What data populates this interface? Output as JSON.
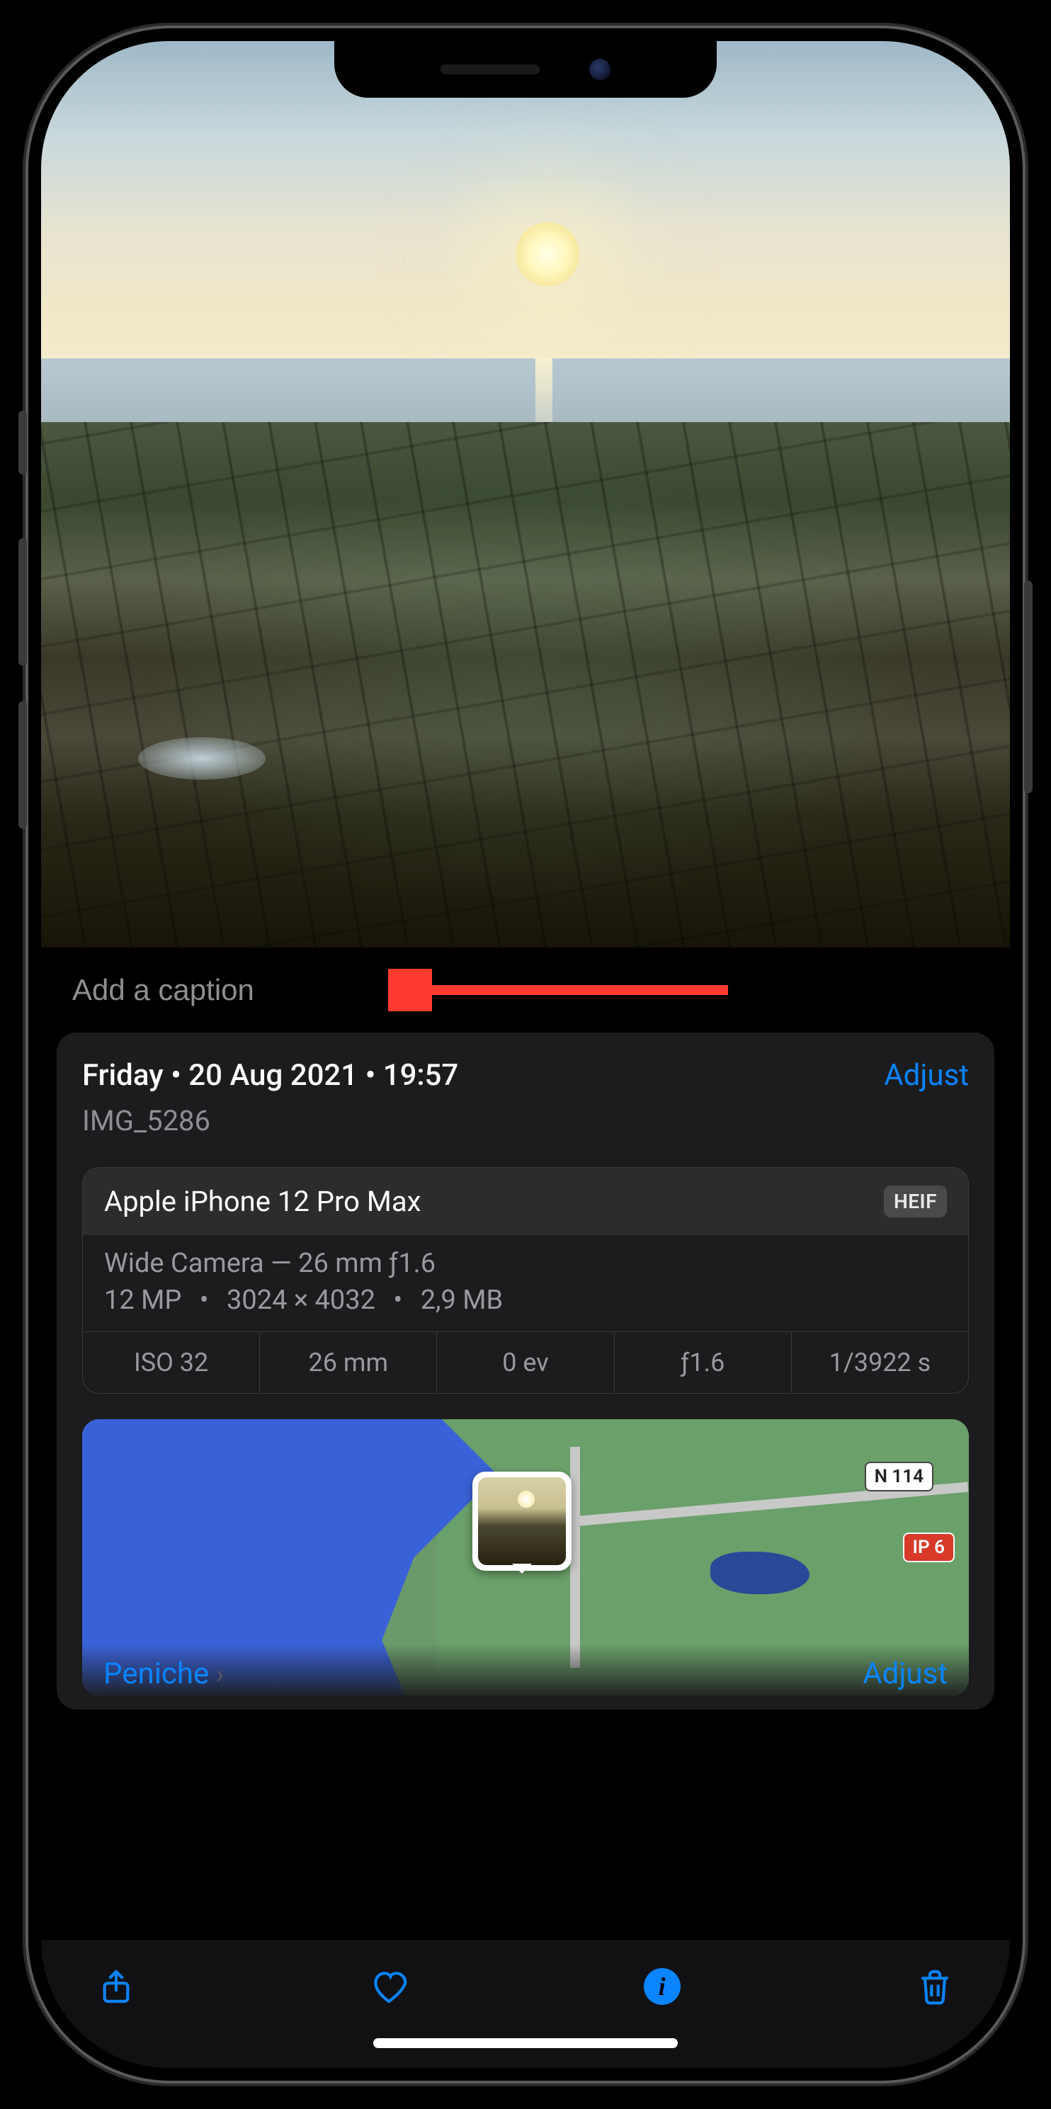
{
  "caption": {
    "placeholder": "Add a caption"
  },
  "info": {
    "date_line": "Friday • 20 Aug 2021 • 19:57",
    "adjust_label": "Adjust",
    "filename": "IMG_5286"
  },
  "device": {
    "model": "Apple iPhone 12 Pro Max",
    "format": "HEIF",
    "lens_line": "Wide Camera — 26 mm ƒ1.6",
    "megapixels": "12 MP",
    "dimensions": "3024 × 4032",
    "filesize": "2,9 MB"
  },
  "exif": {
    "iso": "ISO 32",
    "focal": "26 mm",
    "ev": "0 ev",
    "aperture": "ƒ1.6",
    "shutter": "1/3922 s"
  },
  "map": {
    "road1": "N 114",
    "road2": "IP 6",
    "location": "Peniche",
    "adjust_label": "Adjust"
  },
  "toolbar": {
    "info_glyph": "i"
  }
}
